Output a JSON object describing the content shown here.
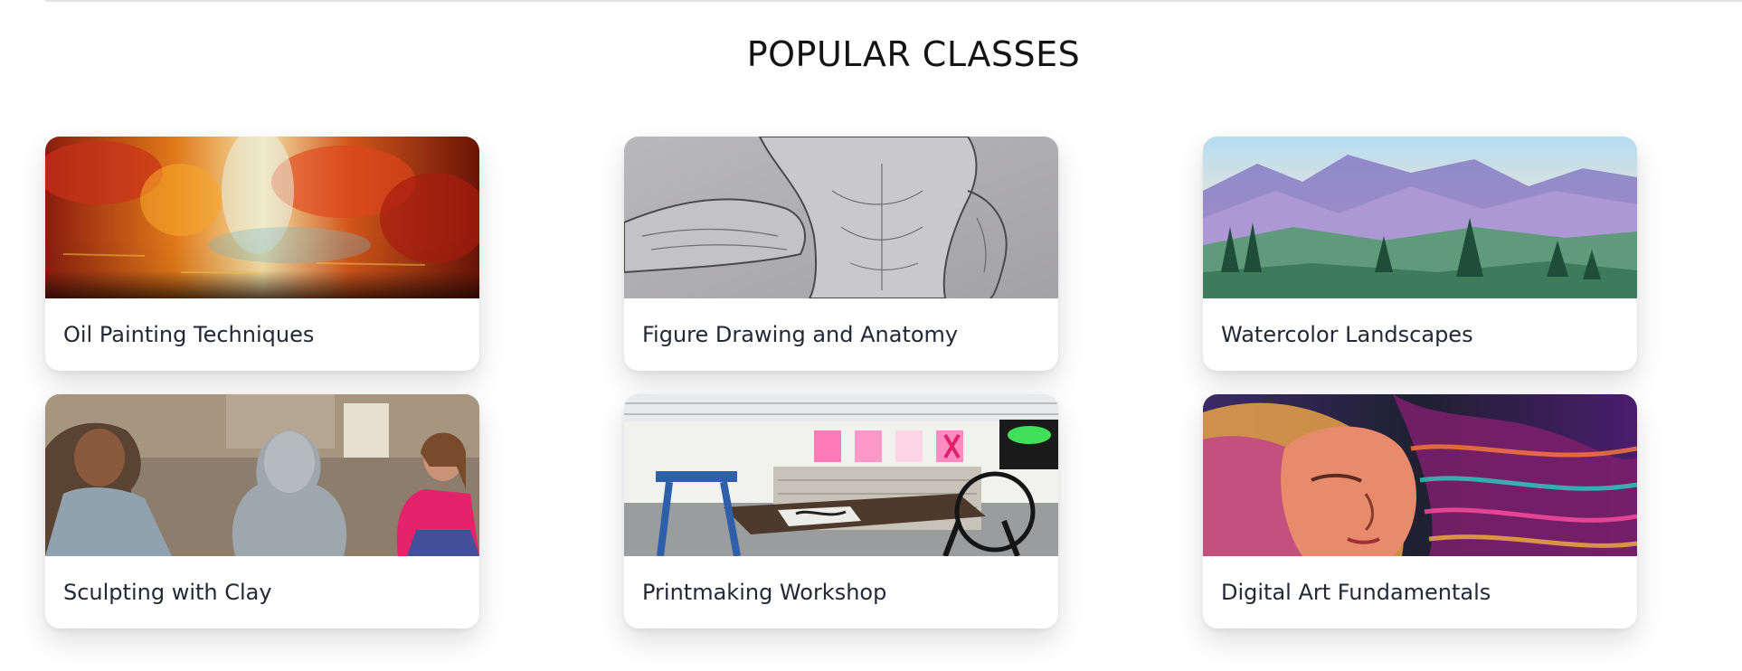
{
  "section": {
    "title": "POPULAR CLASSES"
  },
  "classes": [
    {
      "title": "Oil Painting Techniques",
      "image": "oil-painting-image"
    },
    {
      "title": "Figure Drawing and Anatomy",
      "image": "figure-drawing-image"
    },
    {
      "title": "Watercolor Landscapes",
      "image": "watercolor-landscape-image"
    },
    {
      "title": "Sculpting with Clay",
      "image": "sculpting-image"
    },
    {
      "title": "Printmaking Workshop",
      "image": "printmaking-image"
    },
    {
      "title": "Digital Art Fundamentals",
      "image": "digital-art-image"
    }
  ]
}
